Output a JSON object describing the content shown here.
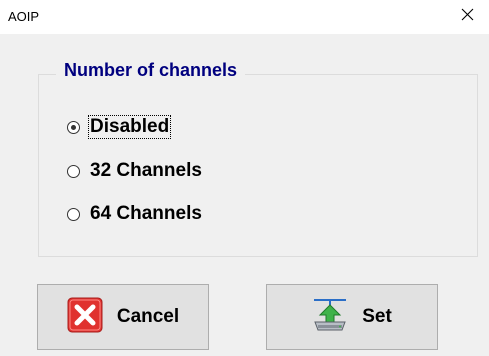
{
  "window": {
    "title": "AOIP",
    "close_icon": "close-icon"
  },
  "group": {
    "title": "Number of channels",
    "options": [
      {
        "label": "Disabled",
        "selected": true
      },
      {
        "label": "32 Channels",
        "selected": false
      },
      {
        "label": "64 Channels",
        "selected": false
      }
    ]
  },
  "buttons": {
    "cancel_label": "Cancel",
    "cancel_icon": "cancel-x-icon",
    "set_label": "Set",
    "set_icon": "upload-drive-icon"
  },
  "colors": {
    "group_title": "#00007f",
    "cancel_icon_red": "#e0322f"
  }
}
